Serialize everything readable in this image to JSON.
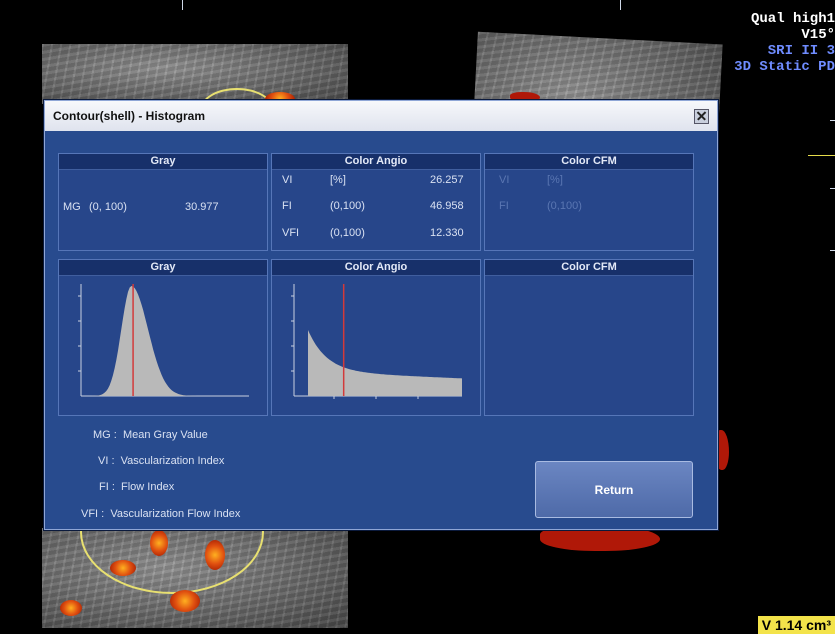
{
  "hud": {
    "line1": "Qual high1",
    "line2": "V15°",
    "line3": "SRI II 3",
    "line4": "3D Static PD",
    "volume": "V 1.14 cm³"
  },
  "dialog": {
    "title": "Contour(shell) - Histogram",
    "close_icon": "close-icon",
    "gray_panel": {
      "header": "Gray",
      "mg_label": "MG",
      "mg_range": "(0, 100)",
      "mg_value": "30.977"
    },
    "color_angio_panel": {
      "header": "Color Angio",
      "rows": [
        {
          "label": "VI",
          "range": "[%]",
          "value": "26.257"
        },
        {
          "label": "FI",
          "range": "(0,100)",
          "value": "46.958"
        },
        {
          "label": "VFI",
          "range": "(0,100)",
          "value": "12.330"
        }
      ]
    },
    "color_cfm_panel": {
      "header": "Color CFM",
      "rows": [
        {
          "label": "VI",
          "range": "[%]"
        },
        {
          "label": "FI",
          "range": "(0,100)"
        }
      ]
    },
    "gray_histogram": {
      "header": "Gray",
      "marker_color": "#d23a3a",
      "bar_color": "#b9b9b9",
      "marker_position": 0.31
    },
    "angio_histogram": {
      "header": "Color Angio",
      "marker_color": "#d23a3a",
      "bar_color": "#b9b9b9",
      "marker_position": 0.26
    },
    "cfm_histogram": {
      "header": "Color CFM"
    },
    "legend": [
      {
        "abbr": "MG :",
        "text": "Mean Gray Value"
      },
      {
        "abbr": "VI :",
        "text": "Vascularization Index"
      },
      {
        "abbr": "FI :",
        "text": "Flow Index"
      },
      {
        "abbr": "VFI :",
        "text": "Vascularization Flow Index"
      }
    ],
    "return_label": "Return"
  },
  "colors": {
    "dialog_bg": "#284b8e",
    "panel_header_bg": "#17306a",
    "titlebar_bg": "#e8ebf3",
    "hud_blue": "#6f8cff",
    "volume_bg": "#f3e34a"
  }
}
